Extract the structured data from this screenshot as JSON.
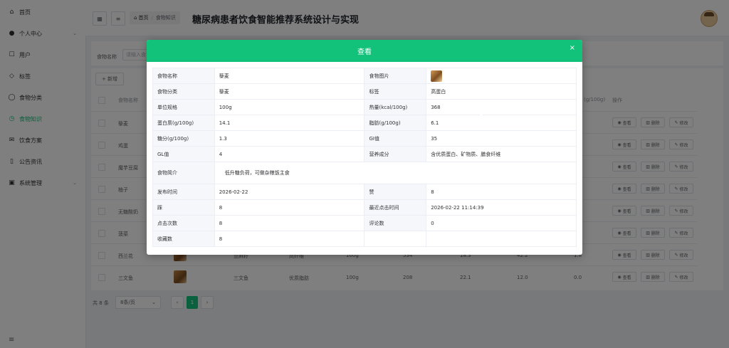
{
  "sidebar": {
    "items": [
      {
        "icon": "home-icon",
        "label": "首页"
      },
      {
        "icon": "user-icon",
        "label": "个人中心",
        "expandable": true
      },
      {
        "icon": "user-outline-icon",
        "label": "用户"
      },
      {
        "icon": "tag-icon",
        "label": "标签"
      },
      {
        "icon": "chat-icon",
        "label": "食物分类"
      },
      {
        "icon": "clock-icon",
        "label": "食物知识",
        "active": true
      },
      {
        "icon": "mail-icon",
        "label": "饮食方案"
      },
      {
        "icon": "book-icon",
        "label": "公告资讯"
      },
      {
        "icon": "settings-icon",
        "label": "系统管理",
        "expandable": true
      }
    ]
  },
  "header": {
    "breadcrumb": {
      "home": "首页",
      "current": "食物知识"
    },
    "title": "糖尿病患者饮食智能推荐系统设计与实现"
  },
  "search": {
    "label": "食物名称",
    "placeholder": "请输入食"
  },
  "toolbar": {
    "add_label": "+ 新增"
  },
  "table": {
    "headers": [
      "食物名称",
      "(g/100g)",
      "操作"
    ],
    "rows": [
      {
        "name": "藜麦",
        "has_image": false
      },
      {
        "name": "鸡蛋",
        "has_image": false
      },
      {
        "name": "魔芋豆腐",
        "has_image": false
      },
      {
        "name": "柚子",
        "has_image": false
      },
      {
        "name": "无糖酸奶",
        "has_image": false
      },
      {
        "name": "菠菜",
        "has_image": false
      },
      {
        "name": "西兰花",
        "cat": "亚麻籽",
        "tag": "高纤维",
        "spec": "100g",
        "energy": "534",
        "protein": "18.3",
        "fat": "42.2",
        "gi": "1.8",
        "has_image": true
      },
      {
        "name": "三文鱼",
        "cat": "三文鱼",
        "tag": "优质脂肪",
        "spec": "100g",
        "energy": "208",
        "protein": "22.1",
        "fat": "12.0",
        "gi": "0.0",
        "has_image": true
      }
    ],
    "actions": {
      "view": "查看",
      "delete": "删除",
      "edit": "修改"
    }
  },
  "pager": {
    "total": "共 8 条",
    "page_size": "8条/页",
    "current_page": "1"
  },
  "modal": {
    "title": "查看",
    "fields": {
      "name_label": "食物名称",
      "name": "藜麦",
      "image_label": "食物图片",
      "category_label": "食物分类",
      "category": "藜麦",
      "tag_label": "标签",
      "tag": "高蛋白",
      "spec_label": "单位规格",
      "spec": "100g",
      "energy_label": "热量(kcal/100g)",
      "energy": "368",
      "protein_label": "蛋白质(g/100g)",
      "protein": "14.1",
      "fat_label": "脂肪(g/100g)",
      "fat": "6.1",
      "sugar_label": "糖分(g/100g)",
      "sugar": "1.3",
      "gi_label": "GI值",
      "gi": "35",
      "gl_label": "GL值",
      "gl": "4",
      "nutrition_label": "营养成分",
      "nutrition": "含优质蛋白、矿物质、膳食纤维",
      "intro_label": "食物简介",
      "intro": "低升糖负荷，可做杂粮饭主食",
      "publish_label": "发布时间",
      "publish": "2026-02-22",
      "like_label": "赞",
      "like": "8",
      "dislike_label": "踩",
      "dislike": "8",
      "last_click_label": "最近点击时间",
      "last_click": "2026-02-22 11:14:39",
      "clicks_label": "点击次数",
      "clicks": "8",
      "comments_label": "评论数",
      "comments": "0",
      "favorites_label": "收藏数",
      "favorites": "8"
    }
  },
  "colors": {
    "accent": "#13c27a",
    "overlay": "rgba(0,0,0,0.5)"
  }
}
